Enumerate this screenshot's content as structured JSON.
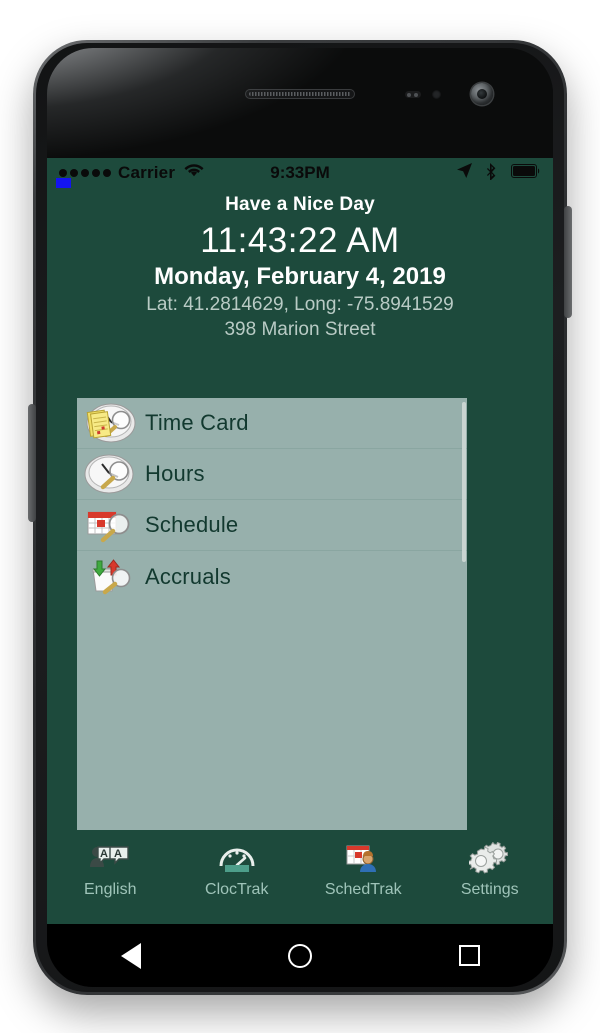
{
  "colors": {
    "header_green": "#1d4a3c",
    "list_sage": "#97b0ac",
    "label_dark": "#12392f",
    "tab_label": "#9fc4b9",
    "muted_text": "#b9cbc5"
  },
  "status_bar": {
    "signal_dots": 5,
    "carrier": "Carrier",
    "wifi_icon": "wifi-icon",
    "time": "9:33PM",
    "location_icon": "location-arrow-icon",
    "bluetooth_icon": "bluetooth-icon",
    "battery_icon": "battery-full-icon"
  },
  "header": {
    "greeting": "Have a Nice Day",
    "clock": "11:43:22 AM",
    "date": "Monday, February 4, 2019",
    "coordinates": "Lat: 41.2814629, Long: -75.8941529",
    "address": "398 Marion Street"
  },
  "menu": {
    "items": [
      {
        "label": "Time Card",
        "icon": "timecard-magnifier-icon"
      },
      {
        "label": "Hours",
        "icon": "clock-magnifier-icon"
      },
      {
        "label": "Schedule",
        "icon": "calendar-magnifier-icon"
      },
      {
        "label": "Accruals",
        "icon": "bucket-arrows-magnifier-icon"
      }
    ]
  },
  "tabbar": {
    "tabs": [
      {
        "label": "English",
        "icon": "language-translate-icon"
      },
      {
        "label": "ClocTrak",
        "icon": "gauge-icon"
      },
      {
        "label": "SchedTrak",
        "icon": "calendar-person-icon"
      },
      {
        "label": "Settings",
        "icon": "gears-icon"
      }
    ]
  },
  "navbar": {
    "back": "back-triangle-icon",
    "home": "home-circle-icon",
    "recents": "recents-square-icon"
  }
}
